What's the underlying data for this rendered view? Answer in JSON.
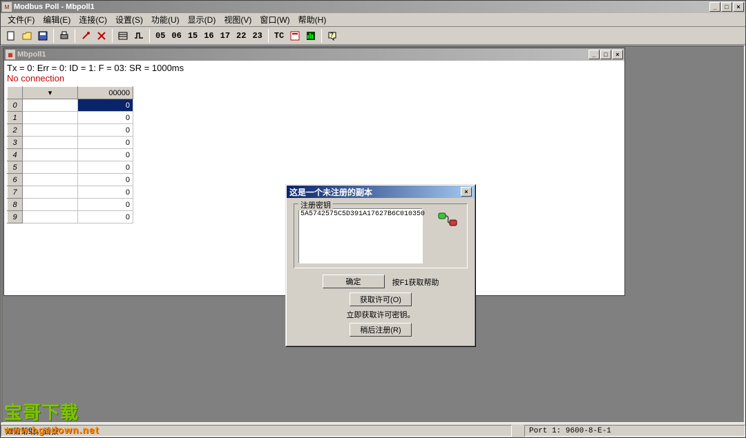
{
  "main_title": "Modbus Poll - Mbpoll1",
  "menu": {
    "file": "文件(F)",
    "edit": "编辑(E)",
    "connection": "连接(C)",
    "setup": "设置(S)",
    "functions": "功能(U)",
    "display": "显示(D)",
    "view": "视图(V)",
    "window": "窗口(W)",
    "help": "帮助(H)"
  },
  "toolbar_codes": [
    "05",
    "06",
    "15",
    "16",
    "17",
    "22",
    "23"
  ],
  "toolbar_tc": "TC",
  "child": {
    "title": "Mbpoll1",
    "status": "Tx = 0: Err = 0: ID = 1: F = 03: SR = 1000ms",
    "noconn": "No connection",
    "col2_header": "00000",
    "rows": [
      {
        "idx": "0",
        "v": "0"
      },
      {
        "idx": "1",
        "v": "0"
      },
      {
        "idx": "2",
        "v": "0"
      },
      {
        "idx": "3",
        "v": "0"
      },
      {
        "idx": "4",
        "v": "0"
      },
      {
        "idx": "5",
        "v": "0"
      },
      {
        "idx": "6",
        "v": "0"
      },
      {
        "idx": "7",
        "v": "0"
      },
      {
        "idx": "8",
        "v": "0"
      },
      {
        "idx": "9",
        "v": "0"
      }
    ]
  },
  "dialog": {
    "title": "这是一个未注册的副本",
    "fieldset_label": "注册密钥",
    "key_text": "5A5742575C5D391A17627B6C010350",
    "ok": "确定",
    "help_hint": "按F1获取帮助",
    "get_license": "获取许可(O)",
    "static": "立即获取许可密钥。",
    "later": "稍后注册(R)"
  },
  "status": {
    "left": "如需帮助，请按",
    "right": "Port 1: 9600-8-E-1"
  },
  "watermark": {
    "line1": "宝哥下载",
    "line2": "www.bgedown.net"
  }
}
